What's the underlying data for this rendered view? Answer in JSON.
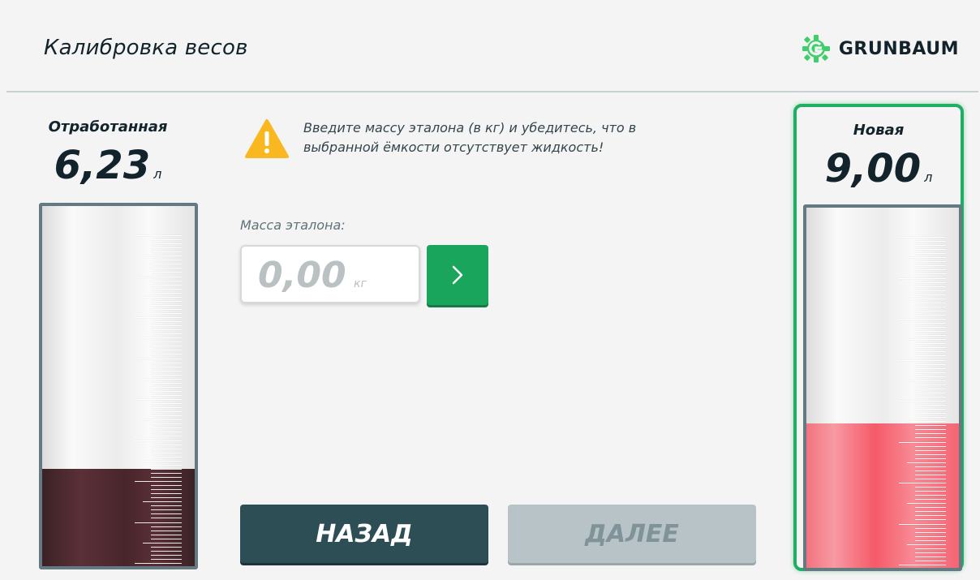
{
  "header": {
    "title": "Калибровка весов",
    "logo_text": "GRUNBAUM",
    "logo_color": "#3ecf6a"
  },
  "left_tank": {
    "label": "Отработанная",
    "value": "6,23",
    "unit": "л",
    "fill_fraction": 0.27,
    "fill_color": "#4a272c"
  },
  "right_tank": {
    "label": "Новая",
    "value": "9,00",
    "unit": "л",
    "fill_fraction": 0.4,
    "fill_color": "#f55a68",
    "selected": true
  },
  "warning": {
    "icon": "warning-triangle-icon",
    "text": "Введите массу эталона (в кг) и убедитесь, что в выбранной ёмкости отсутствует жидкость!"
  },
  "mass": {
    "label": "Масса эталона:",
    "value": "0,00",
    "unit": "кг",
    "submit_icon": "chevron-right-icon"
  },
  "buttons": {
    "back": "НАЗАД",
    "next": "ДАЛЕЕ"
  },
  "colors": {
    "accent_green": "#1aa55d",
    "dark_button": "#2e4e55",
    "disabled_button": "#b7c3c6"
  }
}
